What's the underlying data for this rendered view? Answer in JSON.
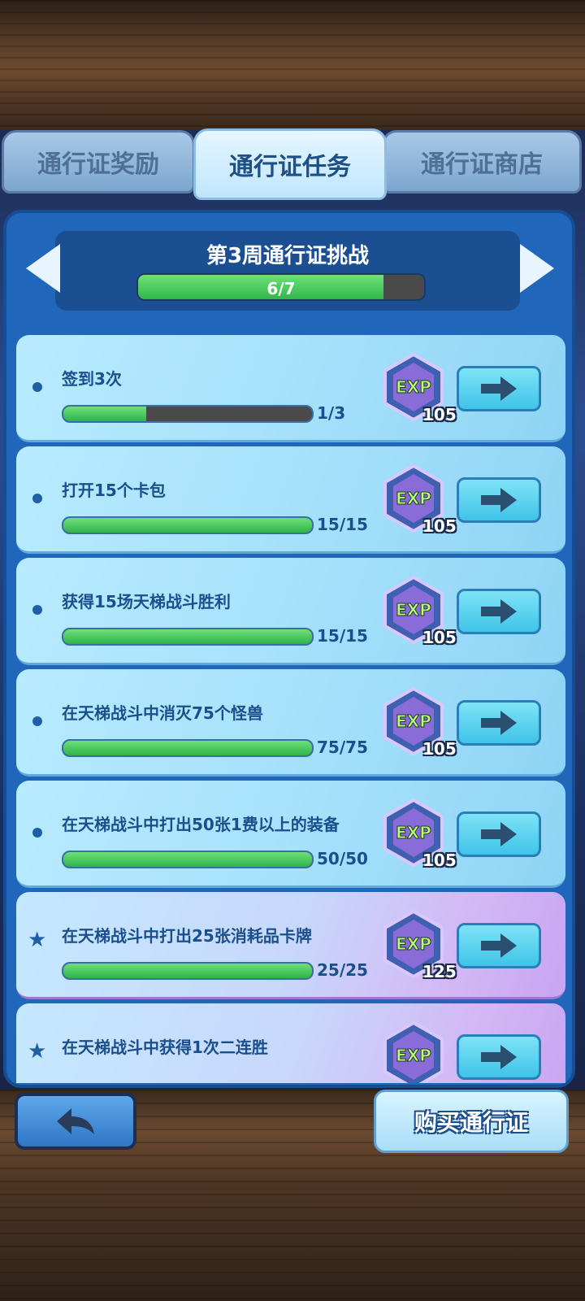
{
  "tabs": [
    {
      "label": "通行证奖励",
      "active": false
    },
    {
      "label": "通行证任务",
      "active": true
    },
    {
      "label": "通行证商店",
      "active": false
    }
  ],
  "challenge": {
    "title": "第3周通行证挑战",
    "progress_text": "6/7",
    "progress_fraction": 0.857
  },
  "tasks": [
    {
      "label": "签到3次",
      "progress_text": "1/3",
      "fraction": 0.333,
      "exp": "105",
      "premium": false
    },
    {
      "label": "打开15个卡包",
      "progress_text": "15/15",
      "fraction": 1.0,
      "exp": "105",
      "premium": false
    },
    {
      "label": "获得15场天梯战斗胜利",
      "progress_text": "15/15",
      "fraction": 1.0,
      "exp": "105",
      "premium": false
    },
    {
      "label": "在天梯战斗中消灭75个怪兽",
      "progress_text": "75/75",
      "fraction": 1.0,
      "exp": "105",
      "premium": false
    },
    {
      "label": "在天梯战斗中打出50张1费以上的装备",
      "progress_text": "50/50",
      "fraction": 1.0,
      "exp": "105",
      "premium": false
    },
    {
      "label": "在天梯战斗中打出25张消耗品卡牌",
      "progress_text": "25/25",
      "fraction": 1.0,
      "exp": "125",
      "premium": true
    },
    {
      "label": "在天梯战斗中获得1次二连胜",
      "progress_text": "",
      "fraction": 0,
      "exp": "",
      "premium": true
    }
  ],
  "exp_label": "EXP",
  "buy_button_label": "购买通行证",
  "icons": {
    "back": "back-arrow-icon",
    "go": "right-arrow-icon",
    "bullet": "dot-icon",
    "premium": "star-icon"
  },
  "colors": {
    "progress_fill": "#30b84a",
    "panel_blue": "#2067bc",
    "task_text": "#1a4f8c",
    "premium_purple": "#c9a4f2"
  }
}
